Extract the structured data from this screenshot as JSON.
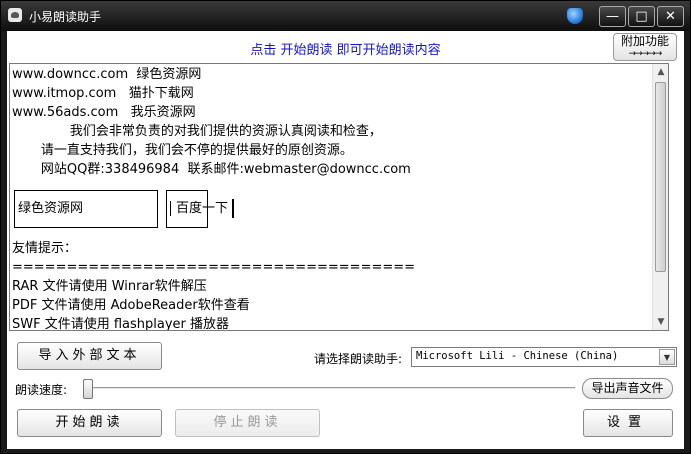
{
  "window": {
    "title": "小易朗读助手",
    "min_glyph": "—",
    "max_glyph": "□",
    "close_glyph": "✕"
  },
  "header": {
    "hint": "点击 开始朗读 即可开始朗读内容",
    "addon_button": "附加功能",
    "addon_arrow": "→→→→→"
  },
  "content": {
    "lines_top": [
      "www.downcc.com  绿色资源网",
      "www.itmop.com   猫扑下载网",
      "www.56ads.com   我乐资源网",
      "              我们会非常负责的对我们提供的资源认真阅读和检查，",
      "       请一直支持我们，我们会不停的提供最好的原创资源。",
      "       网站QQ群:338496984  联系邮件:webmaster@downcc.com"
    ],
    "box_label_1": "绿色资源网",
    "box_label_2": "百度一下",
    "lines_bottom": [
      "友情提示：",
      "=====================================",
      "RAR 文件请使用 Winrar软件解压",
      "PDF 文件请使用 AdobeReader软件查看",
      "SWF 文件请使用 flashplayer 播放器"
    ]
  },
  "controls": {
    "import_button": "导入外部文本",
    "voice_label": "请选择朗读助手:",
    "voice_selected": "Microsoft Lili - Chinese (China)",
    "speed_label": "朗读速度:",
    "speed_level": 0,
    "export_button": "导出声音文件",
    "start_button": "开始朗读",
    "stop_button": "停止朗读",
    "settings_button": "设置"
  },
  "colors": {
    "hint_text": "#1515c8",
    "titlebar": "#1a1a1a"
  }
}
